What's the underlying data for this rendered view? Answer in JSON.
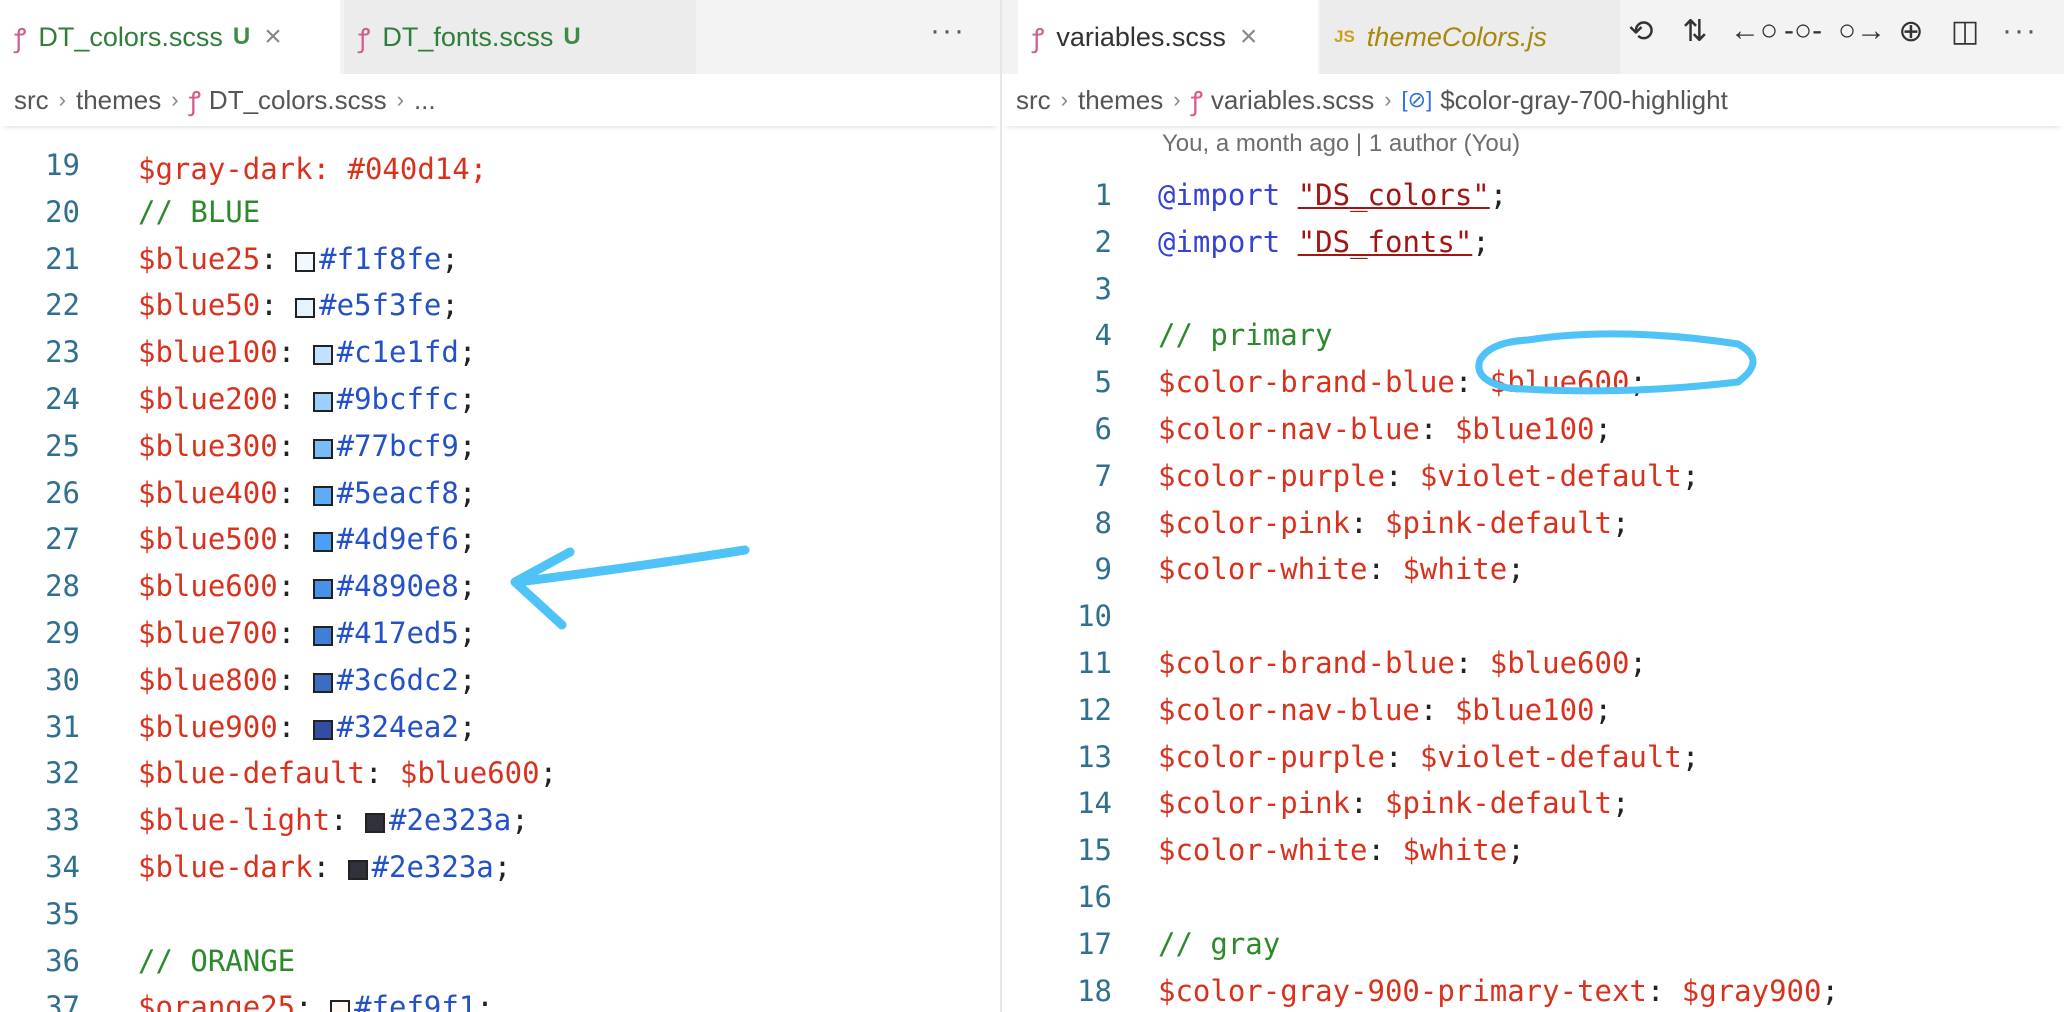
{
  "left": {
    "tabs": [
      {
        "label": "DT_colors.scss",
        "status": "U",
        "close": "×",
        "icon": "scss-file-icon"
      },
      {
        "label": "DT_fonts.scss",
        "status": "U",
        "icon": "scss-file-icon"
      }
    ],
    "more": "···",
    "breadcrumb": [
      "src",
      "themes",
      "DT_colors.scss",
      "..."
    ],
    "partial_line": "$gray-dark: #040d14;",
    "lines": [
      {
        "n": "19",
        "type": "blank"
      },
      {
        "n": "20",
        "type": "comment",
        "text": "// BLUE"
      },
      {
        "n": "21",
        "type": "hexvar",
        "name": "$blue25",
        "hex": "#f1f8fe",
        "swatch": "#f1f8fe"
      },
      {
        "n": "22",
        "type": "hexvar",
        "name": "$blue50",
        "hex": "#e5f3fe",
        "swatch": "#e5f3fe"
      },
      {
        "n": "23",
        "type": "hexvar",
        "name": "$blue100",
        "hex": "#c1e1fd",
        "swatch": "#c1e1fd"
      },
      {
        "n": "24",
        "type": "hexvar",
        "name": "$blue200",
        "hex": "#9bcffc",
        "swatch": "#9bcffc"
      },
      {
        "n": "25",
        "type": "hexvar",
        "name": "$blue300",
        "hex": "#77bcf9",
        "swatch": "#77bcf9"
      },
      {
        "n": "26",
        "type": "hexvar",
        "name": "$blue400",
        "hex": "#5eacf8",
        "swatch": "#5eacf8"
      },
      {
        "n": "27",
        "type": "hexvar",
        "name": "$blue500",
        "hex": "#4d9ef6",
        "swatch": "#4d9ef6"
      },
      {
        "n": "28",
        "type": "hexvar",
        "name": "$blue600",
        "hex": "#4890e8",
        "swatch": "#4890e8"
      },
      {
        "n": "29",
        "type": "hexvar",
        "name": "$blue700",
        "hex": "#417ed5",
        "swatch": "#417ed5"
      },
      {
        "n": "30",
        "type": "hexvar",
        "name": "$blue800",
        "hex": "#3c6dc2",
        "swatch": "#3c6dc2"
      },
      {
        "n": "31",
        "type": "hexvar",
        "name": "$blue900",
        "hex": "#324ea2",
        "swatch": "#324ea2"
      },
      {
        "n": "32",
        "type": "refvar",
        "name": "$blue-default",
        "ref": "$blue600"
      },
      {
        "n": "33",
        "type": "hexvar",
        "name": "$blue-light",
        "hex": "#2e323a",
        "swatch": "#2e323a"
      },
      {
        "n": "34",
        "type": "hexvar",
        "name": "$blue-dark",
        "hex": "#2e323a",
        "swatch": "#2e323a"
      },
      {
        "n": "35",
        "type": "blank"
      },
      {
        "n": "36",
        "type": "comment",
        "text": "// ORANGE"
      },
      {
        "n": "37",
        "type": "hexvar",
        "name": "$orange25",
        "hex": "#fef9f1",
        "swatch": "#fef9f1"
      }
    ]
  },
  "right": {
    "tabs": [
      {
        "label": "variables.scss",
        "close": "×",
        "icon": "scss-file-icon"
      },
      {
        "label": "themeColors.js",
        "icon_text": "JS",
        "icon": "js-file-icon"
      }
    ],
    "actions": [
      {
        "name": "timeline-icon",
        "glyph": "⟲"
      },
      {
        "name": "compare-changes-icon",
        "glyph": "⇅"
      },
      {
        "name": "previous-change-icon",
        "glyph": "←○"
      },
      {
        "name": "commit-icon",
        "glyph": "-○-"
      },
      {
        "name": "next-change-icon",
        "glyph": "○→"
      },
      {
        "name": "git-graph-icon",
        "glyph": "⊕"
      },
      {
        "name": "split-editor-icon",
        "glyph": "◫"
      }
    ],
    "more": "···",
    "breadcrumb": [
      "src",
      "themes",
      "variables.scss",
      "$color-gray-700-highlight"
    ],
    "blame": "You, a month ago | 1 author (You)",
    "lines": [
      {
        "n": "1",
        "type": "import",
        "kw": "@import",
        "str": "\"DS_colors\""
      },
      {
        "n": "2",
        "type": "import",
        "kw": "@import",
        "str": "\"DS_fonts\""
      },
      {
        "n": "3",
        "type": "blank"
      },
      {
        "n": "4",
        "type": "comment",
        "text": "// primary"
      },
      {
        "n": "5",
        "type": "refvar",
        "name": "$color-brand-blue",
        "ref": "$blue600"
      },
      {
        "n": "6",
        "type": "refvar",
        "name": "$color-nav-blue",
        "ref": "$blue100"
      },
      {
        "n": "7",
        "type": "refvar",
        "name": "$color-purple",
        "ref": "$violet-default"
      },
      {
        "n": "8",
        "type": "refvar",
        "name": "$color-pink",
        "ref": "$pink-default"
      },
      {
        "n": "9",
        "type": "refvar",
        "name": "$color-white",
        "ref": "$white"
      },
      {
        "n": "10",
        "type": "blank"
      },
      {
        "n": "11",
        "type": "refvar",
        "name": "$color-brand-blue",
        "ref": "$blue600"
      },
      {
        "n": "12",
        "type": "refvar",
        "name": "$color-nav-blue",
        "ref": "$blue100"
      },
      {
        "n": "13",
        "type": "refvar",
        "name": "$color-purple",
        "ref": "$violet-default"
      },
      {
        "n": "14",
        "type": "refvar",
        "name": "$color-pink",
        "ref": "$pink-default"
      },
      {
        "n": "15",
        "type": "refvar",
        "name": "$color-white",
        "ref": "$white"
      },
      {
        "n": "16",
        "type": "blank"
      },
      {
        "n": "17",
        "type": "comment",
        "text": "// gray"
      },
      {
        "n": "18",
        "type": "refvar",
        "name": "$color-gray-900-primary-text",
        "ref": "$gray900"
      }
    ]
  },
  "colors": {
    "annotation": "#4fc3f7",
    "variable": "#d8321f",
    "hex": "#2451c7",
    "comment": "#2c8a2c"
  }
}
